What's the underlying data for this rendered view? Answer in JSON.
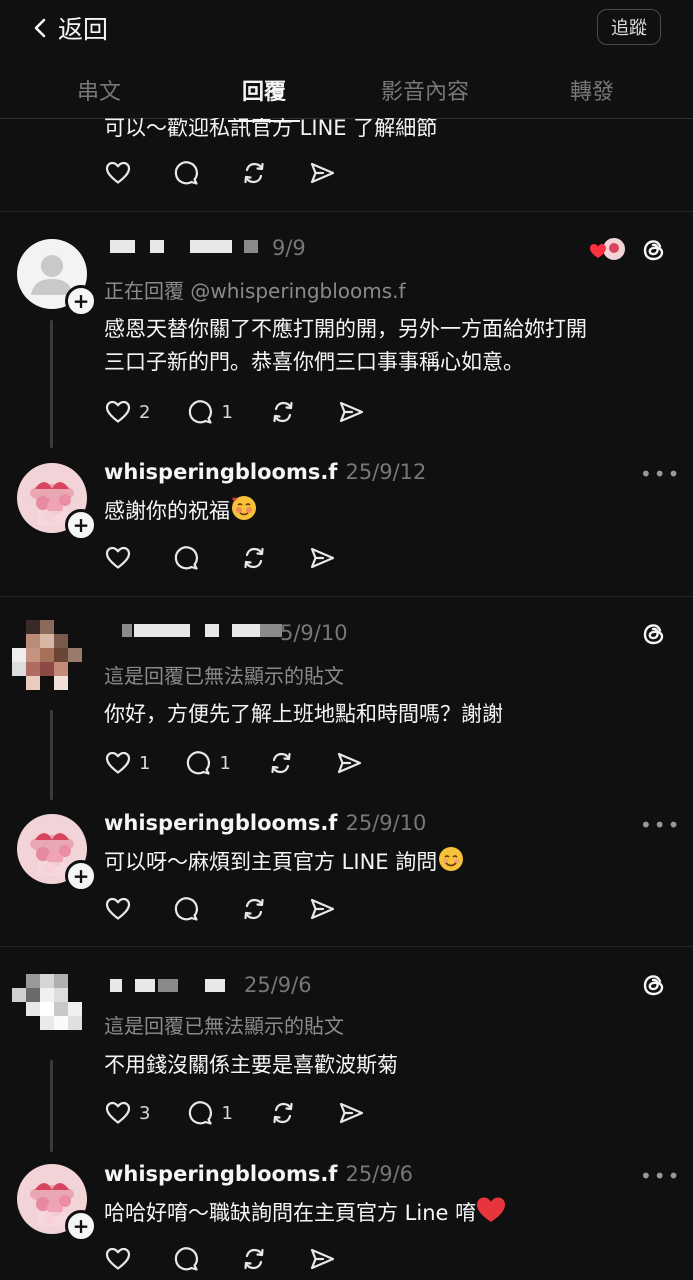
{
  "header": {
    "back_label": "返回",
    "follow_label": "追蹤"
  },
  "tabs": [
    "串文",
    "回覆",
    "影音內容",
    "轉發"
  ],
  "active_tab": "回覆",
  "clipped_text": "可以～歡迎私訊官方 LINE 了解細節",
  "threads": [
    {
      "reply": {
        "date": "9/9",
        "replying_to": "正在回覆 @whisperingblooms.f",
        "text_lines": [
          "感恩天替你關了不應打開的開，另外一方面給妳打開",
          "三口子新的門。恭喜你們三口事事稱心如意。"
        ],
        "likes": "2",
        "comments": "1"
      },
      "answer": {
        "username": "whisperingblooms.f",
        "date": "25/9/12",
        "text": "感謝你的祝福"
      }
    },
    {
      "reply": {
        "date": "5/9/10",
        "replying_to": "這是回覆已無法顯示的貼文",
        "text_lines": [
          "你好，方便先了解上班地點和時間嗎？謝謝"
        ],
        "likes": "1",
        "comments": "1"
      },
      "answer": {
        "username": "whisperingblooms.f",
        "date": "25/9/10",
        "text": "可以呀～麻煩到主頁官方 LINE 詢問"
      }
    },
    {
      "reply": {
        "date": "25/9/6",
        "replying_to": "這是回覆已無法顯示的貼文",
        "text_lines": [
          "不用錢沒關係主要是喜歡波斯菊"
        ],
        "likes": "3",
        "comments": "1"
      },
      "answer": {
        "username": "whisperingblooms.f",
        "date": "25/9/6",
        "text": "哈哈好唷～職缺詢問在主頁官方 Line 唷"
      }
    }
  ]
}
